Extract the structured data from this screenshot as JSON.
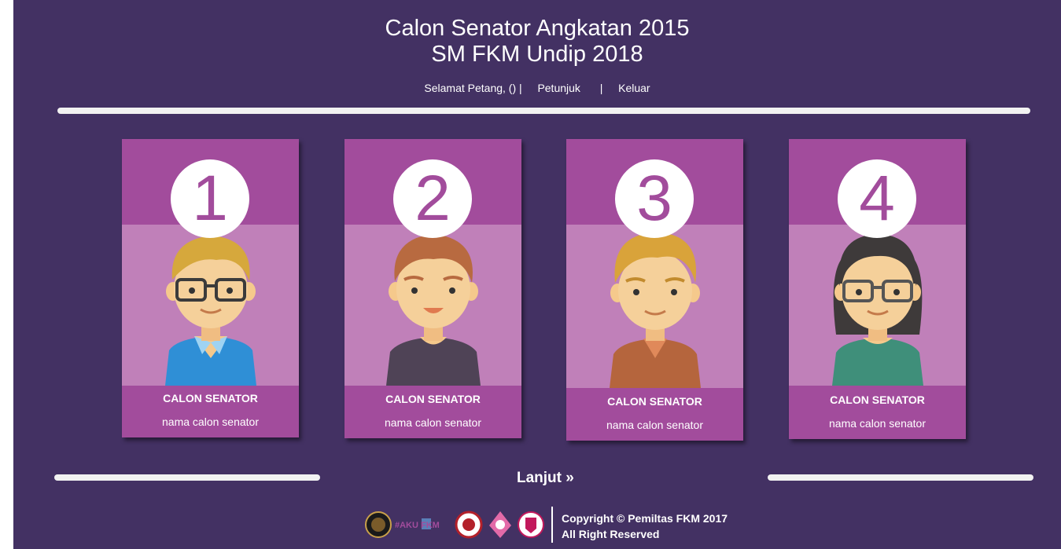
{
  "header": {
    "title_line1": "Calon Senator Angkatan 2015",
    "title_line2": "SM FKM Undip 2018",
    "greeting": "Selamat Petang, () |",
    "separator": "|",
    "help_link": "Petunjuk",
    "logout_link": "Keluar"
  },
  "candidates": [
    {
      "number": "1",
      "role": "CALON SENATOR",
      "name": "nama calon senator",
      "avatar": "man-blond-glasses-avatar"
    },
    {
      "number": "2",
      "role": "CALON SENATOR",
      "name": "nama calon senator",
      "avatar": "man-red-hair-avatar"
    },
    {
      "number": "3",
      "role": "CALON SENATOR",
      "name": "nama calon senator",
      "avatar": "man-blond-avatar"
    },
    {
      "number": "4",
      "role": "CALON SENATOR",
      "name": "nama calon senator",
      "avatar": "woman-glasses-avatar"
    }
  ],
  "next_button": "Lanjut »",
  "footer": {
    "logo_text": "#AKU FKM",
    "copyright": "Copyright © Pemiltas FKM 2017",
    "rights": "All Right Reserved"
  },
  "colors": {
    "background": "#433163",
    "card": "#a24c9c",
    "card_photo": "#c080b9",
    "number_text": "#a24c9c"
  }
}
